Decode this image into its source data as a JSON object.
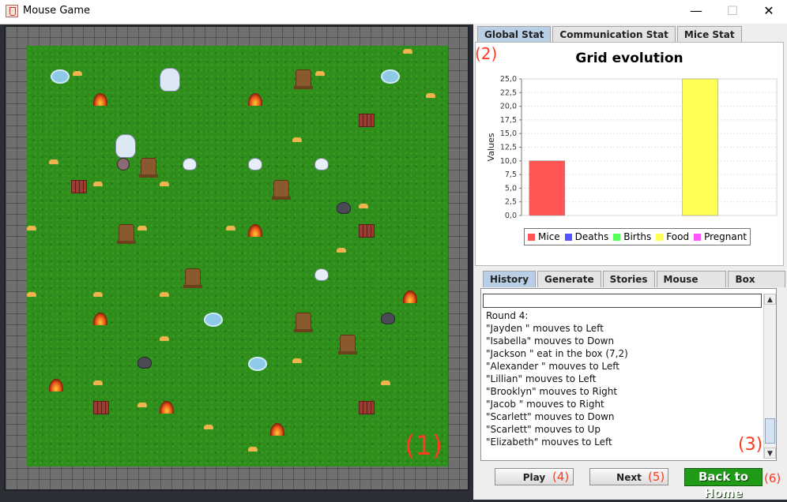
{
  "window": {
    "title": "Mouse Game",
    "min_glyph": "—",
    "max_glyph": "☐",
    "close_glyph": "✕"
  },
  "annotations": {
    "a1": "(1)",
    "a2": "(2)",
    "a3": "(3)",
    "a4": "(4)",
    "a5": "(5)",
    "a6": "(6)"
  },
  "stat_tabs": [
    "Global Stat",
    "Communication Stat",
    "Mice Stat"
  ],
  "chart_data": {
    "type": "bar",
    "title": "Grid evolution",
    "xlabel": "",
    "ylabel": "Values",
    "categories": [
      "Mice",
      "Deaths",
      "Births",
      "Food",
      "Pregnant"
    ],
    "values": [
      10.0,
      0.0,
      0.0,
      25.0,
      0.0
    ],
    "colors": [
      "#ff5555",
      "#5555ff",
      "#55ff55",
      "#ffff55",
      "#ff55ff"
    ],
    "ylim": [
      0,
      25
    ],
    "yticks": [
      "0,0",
      "2,5",
      "5,0",
      "7,5",
      "10,0",
      "12,5",
      "15,0",
      "17,5",
      "20,0",
      "22,5",
      "25,0"
    ],
    "grid": true,
    "legend_position": "bottom"
  },
  "history_tabs": [
    "History",
    "Generate",
    "Stories",
    "Mouse Infos",
    "Box Infos"
  ],
  "history_lines": [
    "Round 4:",
    "\"Jayden \" mouves to Left",
    "\"Isabella\" mouves to Down",
    "\"Jackson \" eat in the box (7,2)",
    "\"Alexander \" mouves to Left",
    "\"Lillian\" mouves to Left",
    "\"Brooklyn\" mouves to Right",
    "\"Jacob \" mouves to Right",
    "\"Scarlett\" mouves to Down",
    "\"Scarlett\" mouves to Up",
    "\"Elizabeth\" mouves to Left"
  ],
  "buttons": {
    "play": "Play",
    "next": "Next",
    "home": "Back to Home"
  }
}
